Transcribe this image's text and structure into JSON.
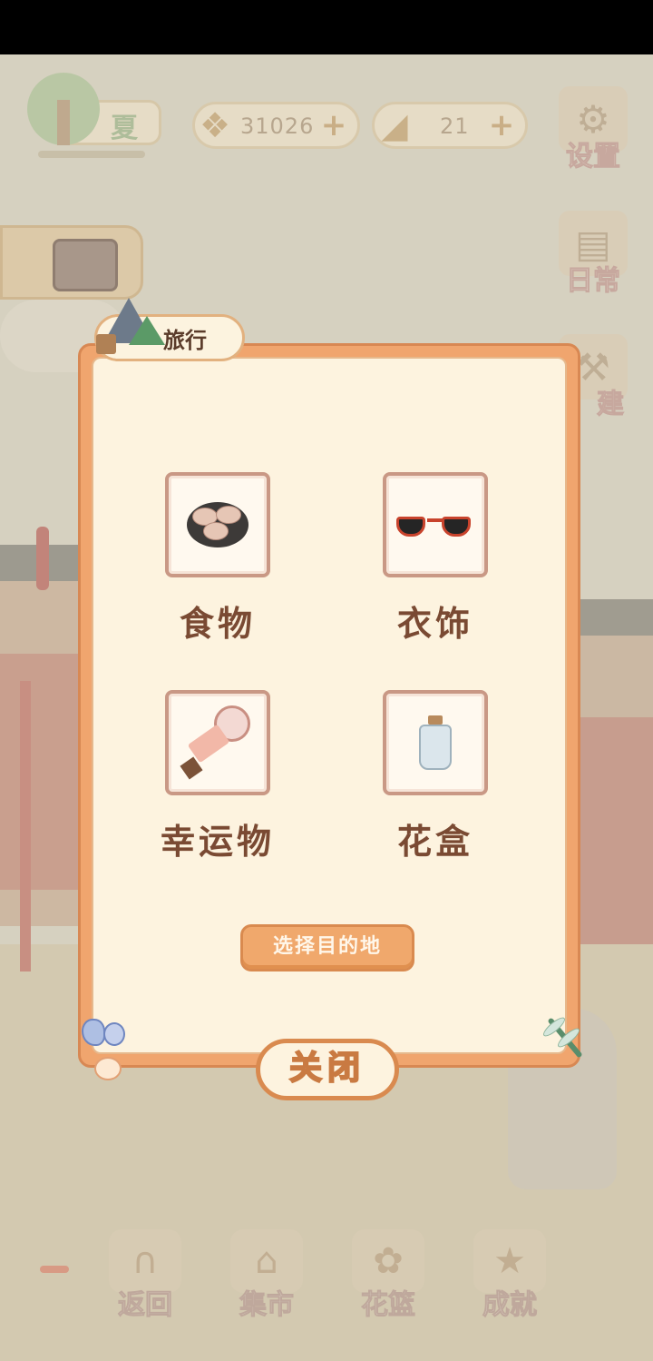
{
  "hud": {
    "season_label": "夏",
    "fish_count": "31026",
    "cheese_count": "21",
    "plus_symbol": "+"
  },
  "side_menu": {
    "settings_label": "设置",
    "daily_label": "日常",
    "build_label": "建"
  },
  "modal": {
    "title": "旅行",
    "categories": [
      {
        "label": "食物",
        "icon": "food-plate-icon"
      },
      {
        "label": "衣饰",
        "icon": "sunglasses-icon"
      },
      {
        "label": "幸运物",
        "icon": "lucky-charm-icon"
      },
      {
        "label": "花盒",
        "icon": "glass-bottle-icon"
      }
    ],
    "destination_button": "选择目的地",
    "close_button": "关闭"
  },
  "bottom_nav": {
    "back_label": "返回",
    "market_label": "集市",
    "basket_label": "花篮",
    "achievement_label": "成就"
  },
  "colors": {
    "modal_border": "#f0a56e",
    "modal_panel": "#fdf3df",
    "category_text": "#7a4a33"
  }
}
